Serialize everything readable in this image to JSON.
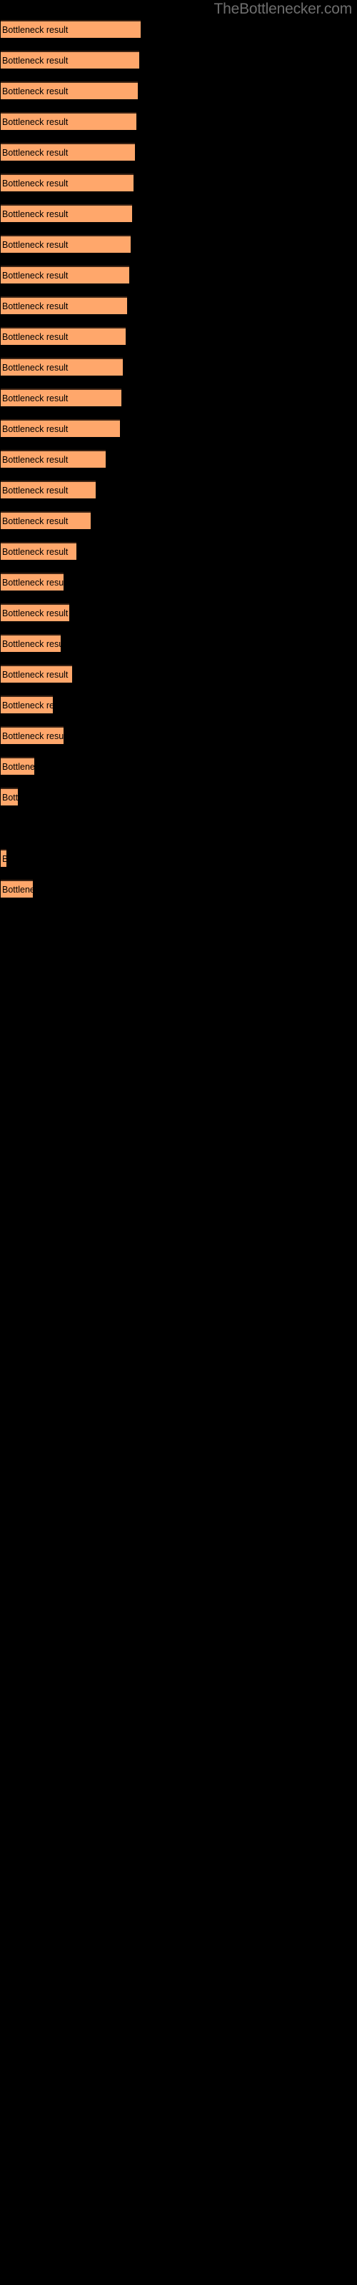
{
  "site": {
    "title": "TheBottlenecker.com",
    "title_color": "#6e6e6e"
  },
  "colors": {
    "background": "#000000",
    "bar_fill": "#ffa76b",
    "bar_border_top": "#3b2314",
    "bar_label_text": "#000000"
  },
  "chart_data": {
    "type": "bar",
    "orientation": "horizontal",
    "title": "",
    "subtitle": "",
    "xlabel": "",
    "ylabel": "",
    "grid": false,
    "legend": false,
    "axis_visible": false,
    "tick_labels": [],
    "bar_label_text": "Bottleneck result",
    "categories": [
      "Bottleneck result",
      "Bottleneck result",
      "Bottleneck result",
      "Bottleneck result",
      "Bottleneck result",
      "Bottleneck result",
      "Bottleneck result",
      "Bottleneck result",
      "Bottleneck result",
      "Bottleneck result",
      "Bottleneck result",
      "Bottleneck result",
      "Bottleneck result",
      "Bottleneck result",
      "Bottleneck result",
      "Bottleneck result",
      "Bottleneck result",
      "Bottleneck result",
      "Bottleneck result",
      "Bottleneck result",
      "Bottleneck result",
      "Bottleneck result",
      "Bottleneck result",
      "Bottleneck result",
      "Bottleneck result",
      "Bottleneck result",
      "Bottleneck result",
      "Bottleneck result"
    ],
    "values": [
      96,
      95,
      94,
      93,
      92,
      91,
      90,
      89,
      88,
      87,
      86,
      84,
      83,
      82,
      72,
      65,
      62,
      52,
      43,
      47,
      41,
      49,
      36,
      43,
      23,
      12,
      4,
      22
    ],
    "xlim": [
      0,
      96
    ],
    "bars": [
      {
        "index": 1,
        "label": "Bottleneck result",
        "value": 96,
        "y": 28,
        "width": 96
      },
      {
        "index": 2,
        "label": "Bottleneck result",
        "value": 95,
        "y": 71,
        "width": 95
      },
      {
        "index": 3,
        "label": "Bottleneck result",
        "value": 94,
        "y": 114,
        "width": 94
      },
      {
        "index": 4,
        "label": "Bottleneck result",
        "value": 93,
        "y": 157,
        "width": 93
      },
      {
        "index": 5,
        "label": "Bottleneck result",
        "value": 92,
        "y": 200,
        "width": 92
      },
      {
        "index": 6,
        "label": "Bottleneck result",
        "value": 91,
        "y": 243,
        "width": 91
      },
      {
        "index": 7,
        "label": "Bottleneck result",
        "value": 90,
        "y": 286,
        "width": 90
      },
      {
        "index": 8,
        "label": "Bottleneck result",
        "value": 89,
        "y": 329,
        "width": 89
      },
      {
        "index": 9,
        "label": "Bottleneck result",
        "value": 88,
        "y": 372,
        "width": 88
      },
      {
        "index": 10,
        "label": "Bottleneck result",
        "value": 87,
        "y": 415,
        "width": 87
      },
      {
        "index": 11,
        "label": "Bottleneck result",
        "value": 86,
        "y": 458,
        "width": 86
      },
      {
        "index": 12,
        "label": "Bottleneck result",
        "value": 84,
        "y": 501,
        "width": 84
      },
      {
        "index": 13,
        "label": "Bottleneck result",
        "value": 83,
        "y": 544,
        "width": 83
      },
      {
        "index": 14,
        "label": "Bottleneck result",
        "value": 82,
        "y": 587,
        "width": 82
      },
      {
        "index": 15,
        "label": "Bottleneck result",
        "value": 72,
        "y": 630,
        "width": 72
      },
      {
        "index": 16,
        "label": "Bottleneck result",
        "value": 65,
        "y": 673,
        "width": 65
      },
      {
        "index": 17,
        "label": "Bottleneck result",
        "value": 62,
        "y": 716,
        "width": 62
      },
      {
        "index": 18,
        "label": "Bottleneck result",
        "value": 52,
        "y": 759,
        "width": 52
      },
      {
        "index": 19,
        "label": "Bottleneck result",
        "value": 43,
        "y": 802,
        "width": 43
      },
      {
        "index": 20,
        "label": "Bottleneck result",
        "value": 47,
        "y": 845,
        "width": 47
      },
      {
        "index": 21,
        "label": "Bottleneck result",
        "value": 41,
        "y": 888,
        "width": 41
      },
      {
        "index": 22,
        "label": "Bottleneck result",
        "value": 49,
        "y": 931,
        "width": 49
      },
      {
        "index": 23,
        "label": "Bottleneck result",
        "value": 36,
        "y": 974,
        "width": 36
      },
      {
        "index": 24,
        "label": "Bottleneck result",
        "value": 43,
        "y": 1017,
        "width": 43
      },
      {
        "index": 25,
        "label": "Bottleneck result",
        "value": 23,
        "y": 1060,
        "width": 23
      },
      {
        "index": 26,
        "label": "Bottleneck result",
        "value": 12,
        "y": 1103,
        "width": 12
      },
      {
        "index": 27,
        "label": "Bottleneck result",
        "value": 4,
        "y": 1189,
        "width": 4
      },
      {
        "index": 28,
        "label": "Bottleneck result",
        "value": 22,
        "y": 1232,
        "width": 22
      }
    ]
  }
}
